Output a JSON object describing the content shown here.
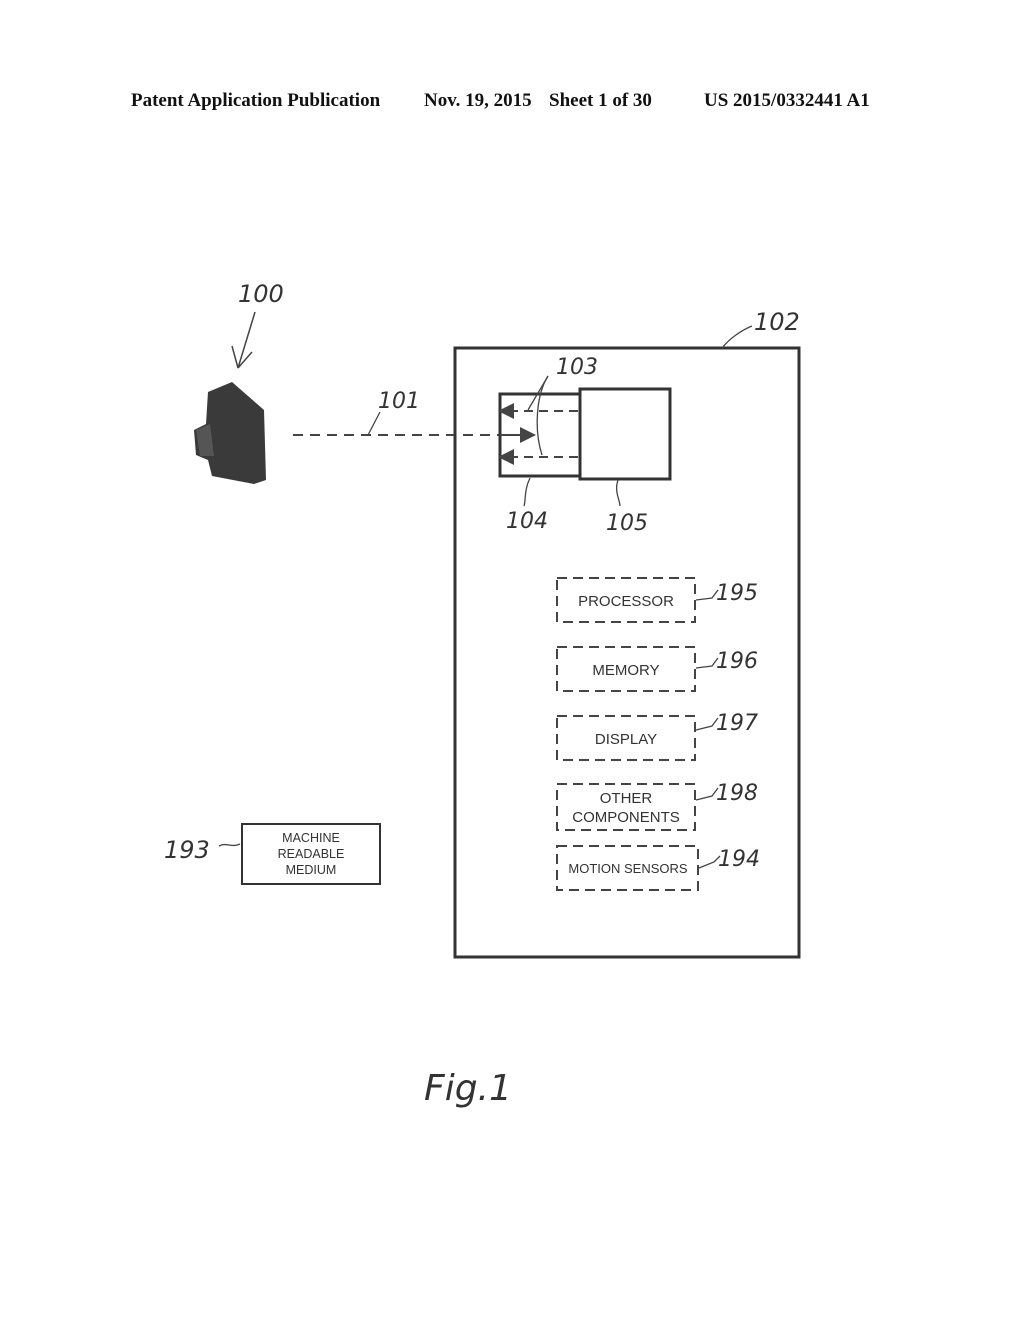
{
  "header": {
    "publication_type": "Patent Application Publication",
    "date": "Nov. 19, 2015",
    "sheet": "Sheet 1 of 30",
    "publication_number": "US 2015/0332441 A1"
  },
  "figure": {
    "caption": "Fig.1",
    "reference_labels": {
      "device": "100",
      "link": "101",
      "system": "102",
      "signals": "103",
      "interface": "104",
      "module": "105",
      "medium": "193",
      "motion_sensors": "194",
      "processor": "195",
      "memory": "196",
      "display": "197",
      "other_components": "198"
    },
    "components": {
      "processor": "PROCESSOR",
      "memory": "MEMORY",
      "display": "DISPLAY",
      "other_components_line1": "OTHER",
      "other_components_line2": "COMPONENTS",
      "motion_sensors": "MOTION SENSORS",
      "medium_line1": "MACHINE",
      "medium_line2": "READABLE",
      "medium_line3": "MEDIUM"
    }
  }
}
